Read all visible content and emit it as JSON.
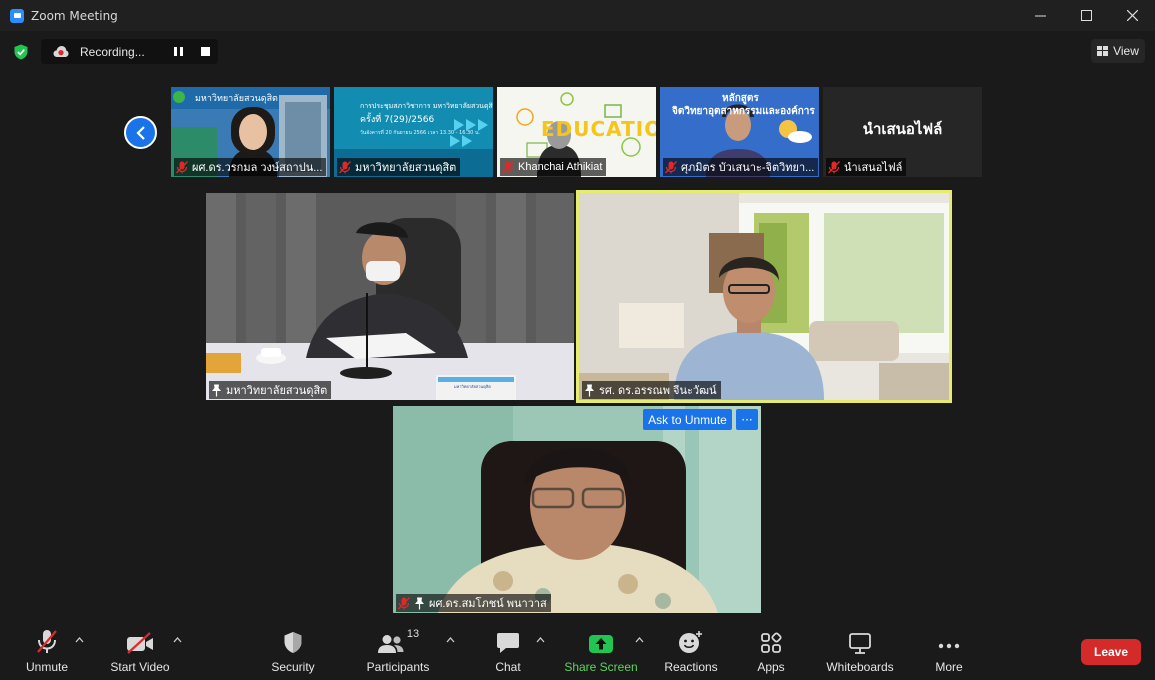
{
  "window": {
    "title": "Zoom Meeting"
  },
  "recording": {
    "label": "Recording..."
  },
  "view": {
    "label": "View"
  },
  "thumbnails": [
    {
      "name": "ผศ.ดร.วรกมล วงษ์สถาปน...",
      "muted": true
    },
    {
      "name": "มหาวิทยาลัยสวนดุสิต",
      "muted": true
    },
    {
      "name": "Khanchai Athikiat",
      "muted": true
    },
    {
      "name": "ศุภมิตร บัวเสนาะ-จิตวิทยา...",
      "muted": true
    },
    {
      "name": "นำเสนอไฟล์",
      "muted": true,
      "placeholder_text": "นำเสนอไฟล์"
    }
  ],
  "thumb_texts": {
    "t1_banner": "มหาวิทยาลัยสวนดุสิต",
    "t2_line1": "การประชุมสภาวิชาการ มหาวิทยาลัยสวนดุสิต",
    "t2_line2": "ครั้งที่ 7(29)/2566",
    "t2_line3": "วันอังคารที่ 20 กันยายน 2566 เวลา 13.30 - 16.30 น.",
    "t3_word": "EDUCATION",
    "t4_line1": "หลักสูตร",
    "t4_line2": "จิตวิทยาอุตสาหกรรมและองค์การ"
  },
  "tiles": [
    {
      "name": "มหาวิทยาลัยสวนดุสิต",
      "pinned": true,
      "desk_sign": "มหาวิทยาลัยสวนดุสิต"
    },
    {
      "name": "รศ. ดร.อรรณพ จีนะวัฒน์",
      "pinned": true,
      "active_speaker": true
    },
    {
      "name": "ผศ.ดร.สมโภชน์ พนาวาส",
      "pinned": true,
      "muted": true
    }
  ],
  "ask_to_unmute": {
    "label": "Ask to Unmute",
    "more": "···"
  },
  "toolbar": {
    "unmute": "Unmute",
    "start_video": "Start Video",
    "security": "Security",
    "participants": "Participants",
    "participants_count": "13",
    "chat": "Chat",
    "share_screen": "Share Screen",
    "reactions": "Reactions",
    "apps": "Apps",
    "whiteboards": "Whiteboards",
    "more": "More",
    "leave": "Leave"
  },
  "colors": {
    "accent_blue": "#1a73e8",
    "share_green": "#23c552",
    "leave_red": "#d42a2a",
    "active_speaker": "#e6ec6f"
  }
}
